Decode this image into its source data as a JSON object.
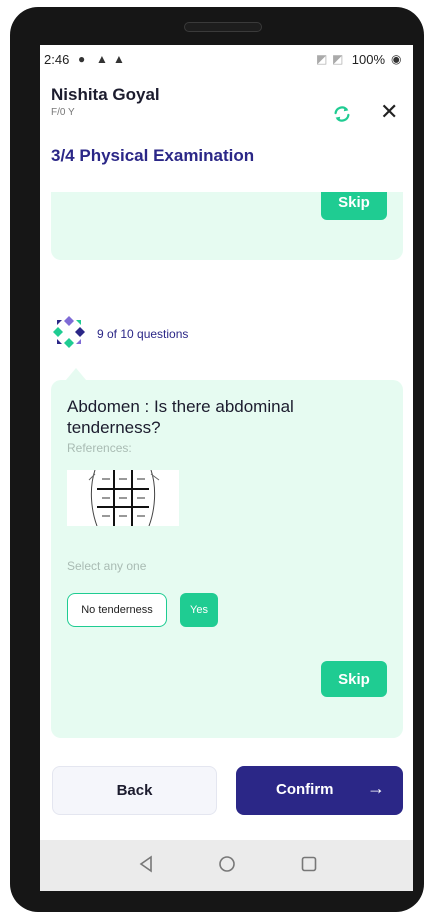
{
  "status_bar": {
    "time": "2:46",
    "battery": "100%"
  },
  "patient": {
    "name": "Nishita Goyal",
    "sub": "F/0 Y"
  },
  "section": {
    "title": "3/4 Physical Examination"
  },
  "prev_card": {
    "skip_label": "Skip"
  },
  "question": {
    "progress": "9 of 10 questions",
    "text": "Abdomen : Is there abdominal tenderness?",
    "references_label": "References:",
    "select_label": "Select any one",
    "options": [
      "No tenderness",
      "Yes"
    ],
    "skip_label": "Skip"
  },
  "footer": {
    "back_label": "Back",
    "confirm_label": "Confirm"
  },
  "colors": {
    "accent": "#1fcc92",
    "primary": "#2b2787",
    "card_bg": "#e6fbf1"
  }
}
